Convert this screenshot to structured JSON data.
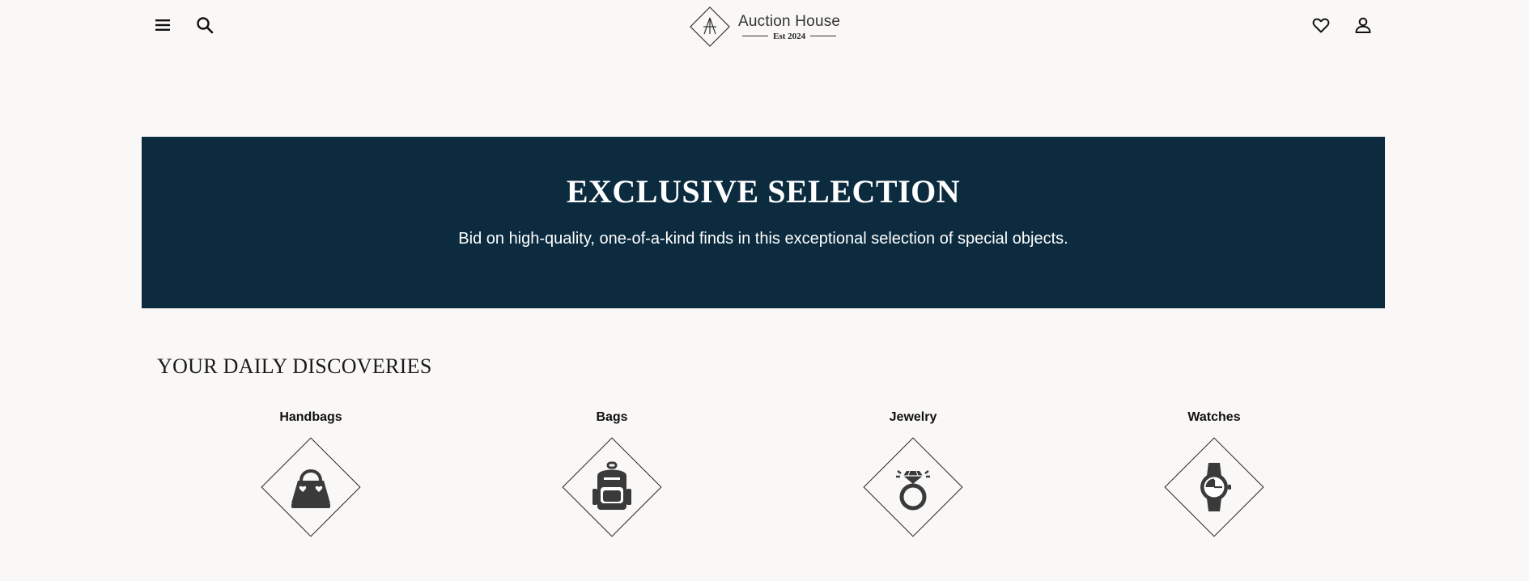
{
  "header": {
    "logo": {
      "monogram": "AH",
      "name": "Auction House",
      "established": "Est 2024"
    },
    "icons": {
      "menu": "hamburger-menu-icon",
      "search": "search-icon",
      "wishlist": "heart-icon",
      "account": "user-icon"
    }
  },
  "hero": {
    "title": "EXCLUSIVE SELECTION",
    "subtitle": "Bid on high-quality, one-of-a-kind finds in this exceptional selection of special objects.",
    "background_color": "#0c2b3f"
  },
  "discoveries": {
    "title": "YOUR DAILY DISCOVERIES",
    "categories": [
      {
        "label": "Handbags",
        "icon": "handbag-icon"
      },
      {
        "label": "Bags",
        "icon": "backpack-icon"
      },
      {
        "label": "Jewelry",
        "icon": "ring-icon"
      },
      {
        "label": "Watches",
        "icon": "watch-icon"
      }
    ]
  },
  "colors": {
    "page_background": "#f9f8f6",
    "icon": "#3a3a3a",
    "hero_text": "#ffffff"
  }
}
